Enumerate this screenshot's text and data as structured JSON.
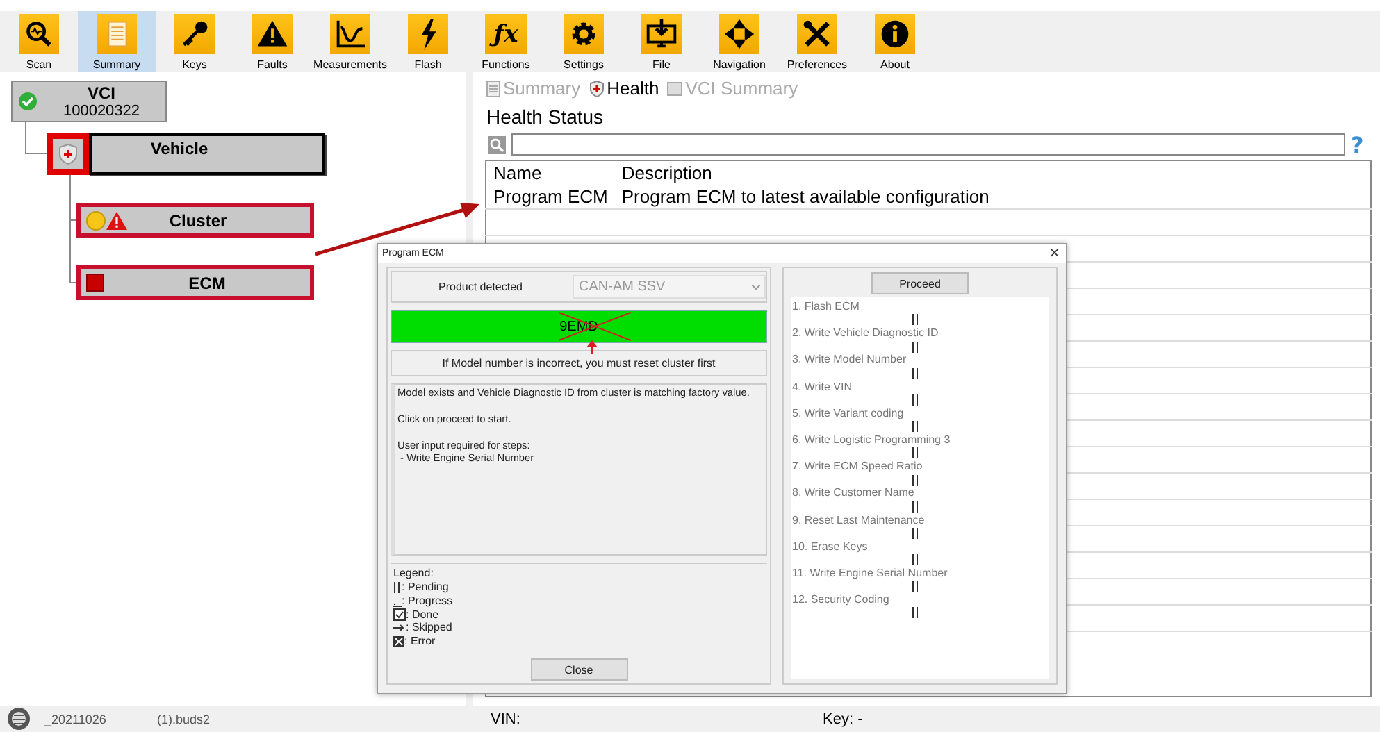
{
  "toolbar": {
    "items": [
      {
        "label": "Scan",
        "selected": false
      },
      {
        "label": "Summary",
        "selected": true
      },
      {
        "label": "Keys",
        "selected": false
      },
      {
        "label": "Faults",
        "selected": false
      },
      {
        "label": "Measurements",
        "selected": false
      },
      {
        "label": "Flash",
        "selected": false
      },
      {
        "label": "Functions",
        "selected": false,
        "glyph": "ƒx"
      },
      {
        "label": "Settings",
        "selected": false
      },
      {
        "label": "File",
        "selected": false
      },
      {
        "label": "Navigation",
        "selected": false
      },
      {
        "label": "Preferences",
        "selected": false
      },
      {
        "label": "About",
        "selected": false
      }
    ]
  },
  "tree": {
    "label": "VCI",
    "sublabel": "100020322",
    "kind": "ok",
    "highlighted": false,
    "selected": false,
    "children": [
      {
        "label": "Vehicle",
        "kind": "vehicle",
        "highlighted": true,
        "selected": true,
        "children": [
          {
            "label": "Cluster",
            "kind": "warning",
            "highlighted": true,
            "selected": false
          },
          {
            "label": "ECM",
            "kind": "error",
            "highlighted": true,
            "selected": false
          }
        ]
      }
    ]
  },
  "tabs": [
    {
      "label": "Summary",
      "selected": false
    },
    {
      "label": "Health",
      "selected": true
    },
    {
      "label": "VCI Summary",
      "selected": false
    }
  ],
  "health": {
    "title": "Health Status",
    "help": "?",
    "table": {
      "columns": [
        "Name",
        "Description"
      ],
      "rows": [
        [
          "Program ECM",
          "Program ECM to latest available configuration"
        ]
      ]
    }
  },
  "dialog": {
    "title": "Program ECM",
    "close": "×",
    "product_label": "Product detected",
    "product_value": "CAN-AM SSV",
    "product_disabled": true,
    "model": "9EMD",
    "model_crossed_out": true,
    "warning": "If Model number is incorrect, you must reset cluster first",
    "info": [
      "Model exists and Vehicle Diagnostic ID from cluster is matching factory value.",
      "Click on proceed to start.",
      "User input required for steps:\n - Write Engine Serial Number"
    ],
    "legend": {
      "title": "Legend:",
      "items": [
        {
          "kind": "pending",
          "label": ": Pending"
        },
        {
          "kind": "progress",
          "label": ": Progress"
        },
        {
          "kind": "done",
          "label": ": Done"
        },
        {
          "kind": "skipped",
          "label": ": Skipped"
        },
        {
          "kind": "error",
          "label": ": Error"
        }
      ]
    },
    "close_button": "Close",
    "proceed_button": "Proceed",
    "steps": [
      {
        "label": "1. Flash ECM",
        "kind": "pending"
      },
      {
        "label": "2. Write Vehicle Diagnostic ID",
        "kind": "pending"
      },
      {
        "label": "3. Write Model Number",
        "kind": "pending"
      },
      {
        "label": "4. Write VIN",
        "kind": "pending"
      },
      {
        "label": "5. Write Variant coding",
        "kind": "pending"
      },
      {
        "label": "6. Write Logistic Programming 3",
        "kind": "pending"
      },
      {
        "label": "7. Write ECM Speed Ratio",
        "kind": "pending"
      },
      {
        "label": "8. Write Customer Name",
        "kind": "pending"
      },
      {
        "label": "9. Reset Last Maintenance",
        "kind": "pending"
      },
      {
        "label": "10. Erase Keys",
        "kind": "pending"
      },
      {
        "label": "11. Write Engine Serial Number",
        "kind": "pending"
      },
      {
        "label": "12. Security Coding",
        "kind": "pending"
      }
    ]
  },
  "status_bar": {
    "file_date": "_20211026",
    "file_name": "(1).buds2",
    "vin": "VIN:",
    "key": "Key: -"
  }
}
